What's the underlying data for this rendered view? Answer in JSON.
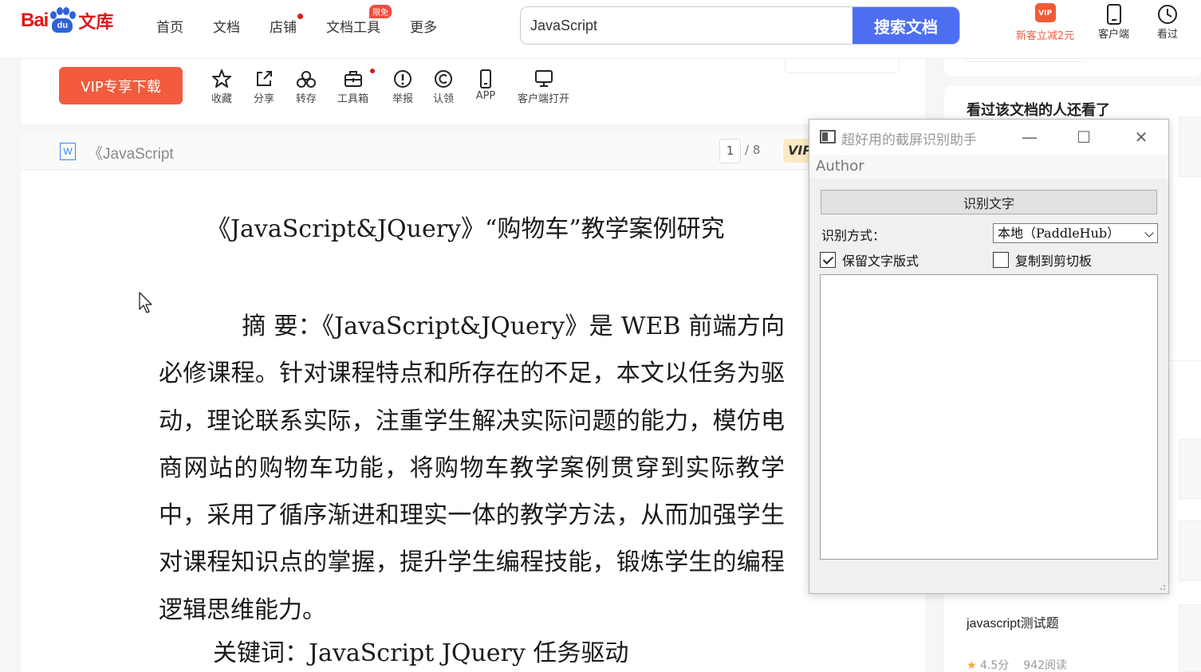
{
  "header": {
    "logo": {
      "bai": "Bai",
      "du": "du",
      "ku": "文库"
    },
    "nav": [
      {
        "label": "首页"
      },
      {
        "label": "文档"
      },
      {
        "label": "店铺",
        "dot": true
      },
      {
        "label": "文档工具",
        "badge": "限免"
      },
      {
        "label": "更多"
      }
    ],
    "search": {
      "value": "JavaScript",
      "button": "搜索文档"
    },
    "right": {
      "vip_icon": "VIP",
      "vip_promo": "新客立减2元",
      "client": "客户端",
      "history": "看过"
    }
  },
  "toolbar": {
    "vip_download": "VIP专享下载",
    "tools": [
      {
        "label": "收藏",
        "icon": "star-icon"
      },
      {
        "label": "分享",
        "icon": "share-icon"
      },
      {
        "label": "转存",
        "icon": "transfer-icon"
      },
      {
        "label": "工具箱",
        "icon": "toolbox-icon",
        "dot": true
      },
      {
        "label": "举报",
        "icon": "report-icon"
      },
      {
        "label": "认领",
        "icon": "copyright-icon"
      },
      {
        "label": "APP",
        "icon": "phone-icon"
      },
      {
        "label": "客户端打开",
        "icon": "monitor-icon"
      }
    ]
  },
  "doc_header": {
    "file_icon": "W",
    "title": "《JavaScript",
    "page_current": "1",
    "page_total": "/ 8",
    "vip_tag": "VIP"
  },
  "document": {
    "title": "《JavaScript&JQuery》“购物车”教学案例研究",
    "abstract": "摘 要：《JavaScript&JQuery》是 WEB 前端方向必修课程。针对课程特点和所存在的不足，本文以任务为驱动，理论联系实际，注重学生解决实际问题的能力，模仿电商网站的购物车功能，将购物车教学案例贯穿到实际教学中，采用了循序渐进和理实一体的教学方法，从而加强学生对课程知识点的掌握，提升学生编程技能，锻炼学生的编程逻辑思维能力。",
    "keywords": "关键词：JavaScript JQuery  任务驱动"
  },
  "sidebar": {
    "title": "看过该文档的人还看了",
    "item": {
      "title": "javascript测试题",
      "rating": "4.5分",
      "reads": "942阅读"
    }
  },
  "ocr_dialog": {
    "title": "超好用的截屏识别助手",
    "menu": "Author",
    "recognize_button": "识别文字",
    "mode_label": "识别方式：",
    "mode_value": "本地（PaddleHub）",
    "keep_layout": {
      "label": "保留文字版式",
      "checked": true
    },
    "copy_clipboard": {
      "label": "复制到剪切板",
      "checked": false
    },
    "result_text": ""
  },
  "colors": {
    "brand_red": "#e0171b",
    "search_blue": "#4e6ef2",
    "vip_orange": "#f25b3d"
  }
}
